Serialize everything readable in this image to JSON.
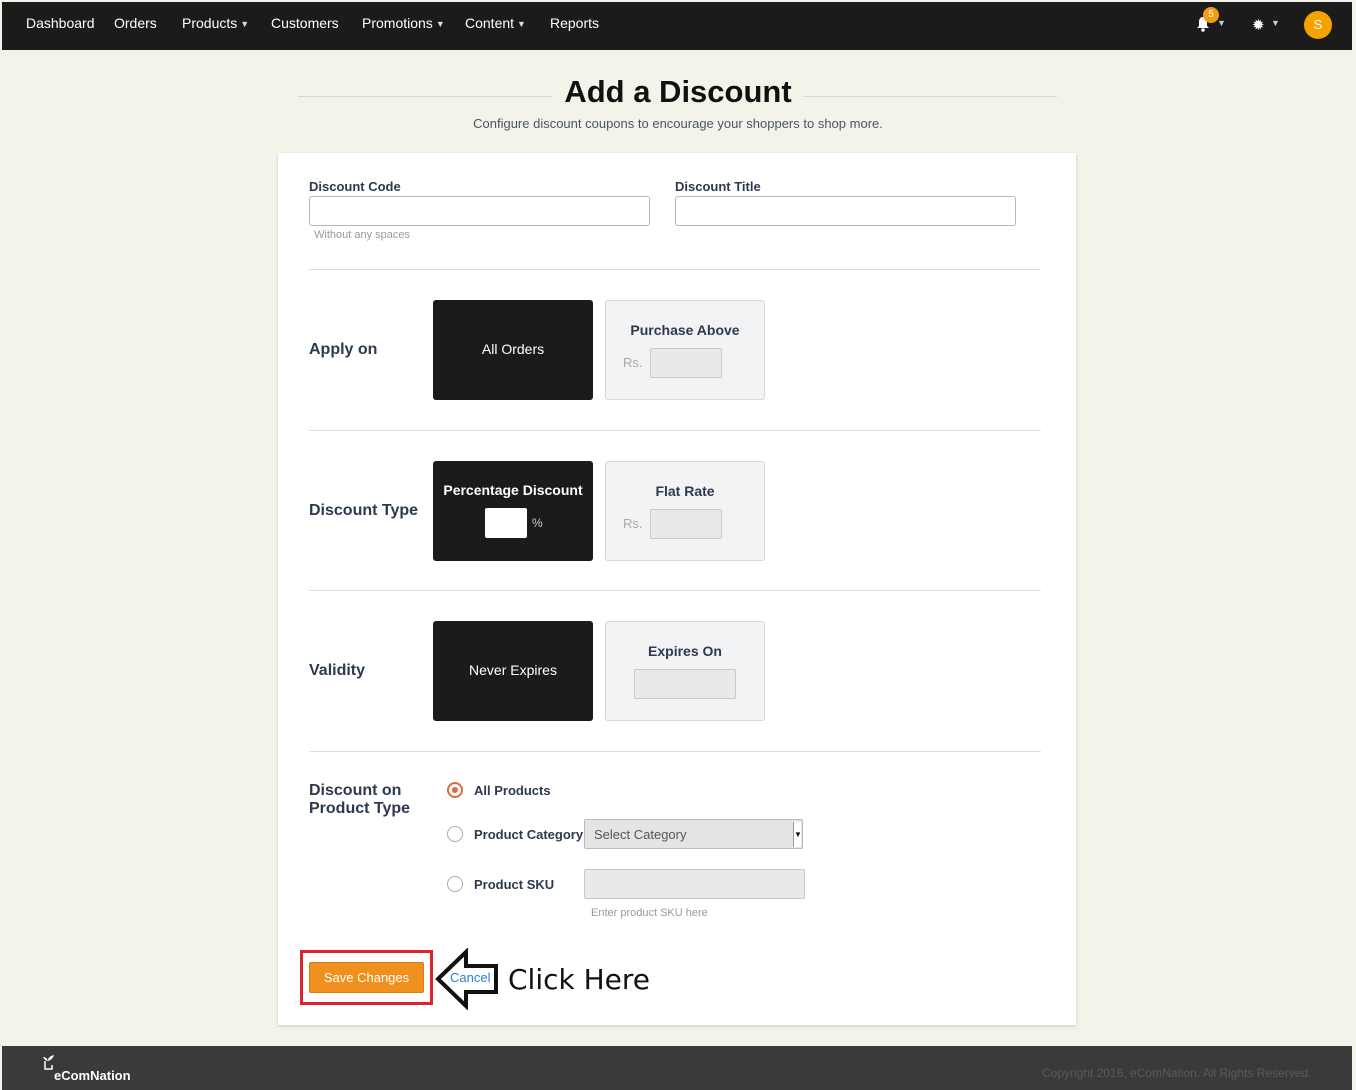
{
  "nav": {
    "items": [
      "Dashboard",
      "Orders",
      "Products",
      "Customers",
      "Promotions",
      "Content",
      "Reports"
    ],
    "notifications_count": "5",
    "avatar_initial": "S"
  },
  "header": {
    "title": "Add a Discount",
    "subtitle": "Configure discount coupons to encourage your shoppers to shop more."
  },
  "form": {
    "discount_code_label": "Discount Code",
    "discount_code_value": "",
    "discount_code_hint": "Without any spaces",
    "discount_title_label": "Discount Title",
    "discount_title_value": "",
    "apply_on": {
      "label": "Apply on",
      "option_all": "All Orders",
      "option_purchase": "Purchase Above",
      "currency": "Rs.",
      "selected": "All Orders"
    },
    "discount_type": {
      "label": "Discount Type",
      "option_percentage": "Percentage Discount",
      "percent_sign": "%",
      "option_flat": "Flat Rate",
      "currency": "Rs.",
      "selected": "Percentage Discount"
    },
    "validity": {
      "label": "Validity",
      "option_never": "Never Expires",
      "option_expires": "Expires On",
      "selected": "Never Expires"
    },
    "product_type": {
      "label_line1": "Discount on",
      "label_line2": "Product Type",
      "option_all": "All Products",
      "option_category": "Product Category",
      "category_select": "Select Category",
      "option_sku": "Product SKU",
      "sku_hint": "Enter product SKU here",
      "selected": "All Products"
    },
    "save_label": "Save Changes",
    "cancel_label": "Cancel"
  },
  "annotation": {
    "callout_text": "Click Here",
    "highlight_color": "#e0212e"
  },
  "footer": {
    "brand": "eComNation",
    "copyright": "Copyright 2016, eComNation. All Rights Reserved."
  },
  "colors": {
    "nav_bg": "#1b1b1b",
    "page_bg": "#f4f3ea",
    "accent_orange": "#f0901f",
    "selected_option_bg": "#1b1b1b"
  }
}
